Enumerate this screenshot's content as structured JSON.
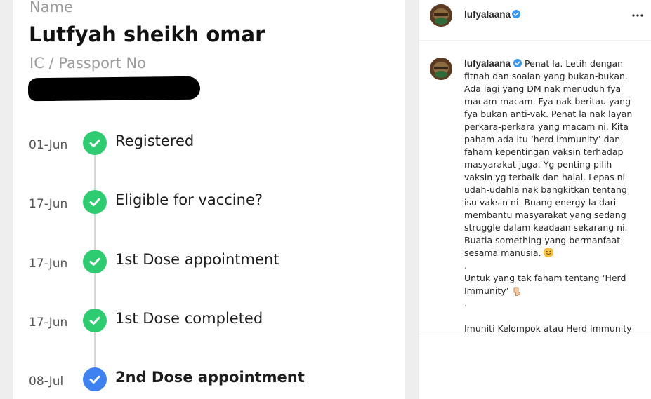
{
  "vaccine_card": {
    "name_label": "Name",
    "name_value": "Lutfyah sheikh omar",
    "ic_label": "IC / Passport No",
    "steps": [
      {
        "date": "01-Jun",
        "text": "Registered",
        "status": "done"
      },
      {
        "date": "17-Jun",
        "text": "Eligible for vaccine?",
        "status": "done"
      },
      {
        "date": "17-Jun",
        "text": "1st Dose appointment",
        "status": "done"
      },
      {
        "date": "17-Jun",
        "text": "1st Dose completed",
        "status": "done"
      },
      {
        "date": "08-Jul",
        "text": "2nd Dose appointment",
        "status": "current"
      }
    ],
    "colors": {
      "done": "#2ecc71",
      "current": "#3d82f0"
    }
  },
  "post": {
    "username": "lufyalaana",
    "more_icon": "more-horizontal-icon",
    "verified_icon": "verified-badge-icon",
    "caption_lines": [
      "Penat la. Letih dengan",
      "fitnah dan soalan yang bukan-bukan.",
      "Ada lagi yang DM nak menuduh fya",
      "macam-macam. Fya nak beritau yang",
      "fya bukan anti-vak. Penat la nak layan",
      "perkara-perkara yang macam ni. Kita",
      "paham ada itu ‘herd immunity’ dan",
      "faham kepentingan vaksin terhadap",
      "masyarakat juga. Yg penting pilih",
      "vaksin yg terbaik dan halal. Lepas ni",
      "udah-udahla nak bangkitkan tentang",
      "isu vaksin ni. Buang energy la dari",
      "membantu masyarakat yang sedang",
      "struggle dalam keadaan sekarang ni.",
      "Buatla something yang bermanfaat",
      "sesama manusia.",
      ".",
      "Untuk yang tak faham tentang ‘Herd",
      "Immunity’",
      ".",
      "",
      "Imuniti Kelompok atau Herd Immunity"
    ]
  }
}
